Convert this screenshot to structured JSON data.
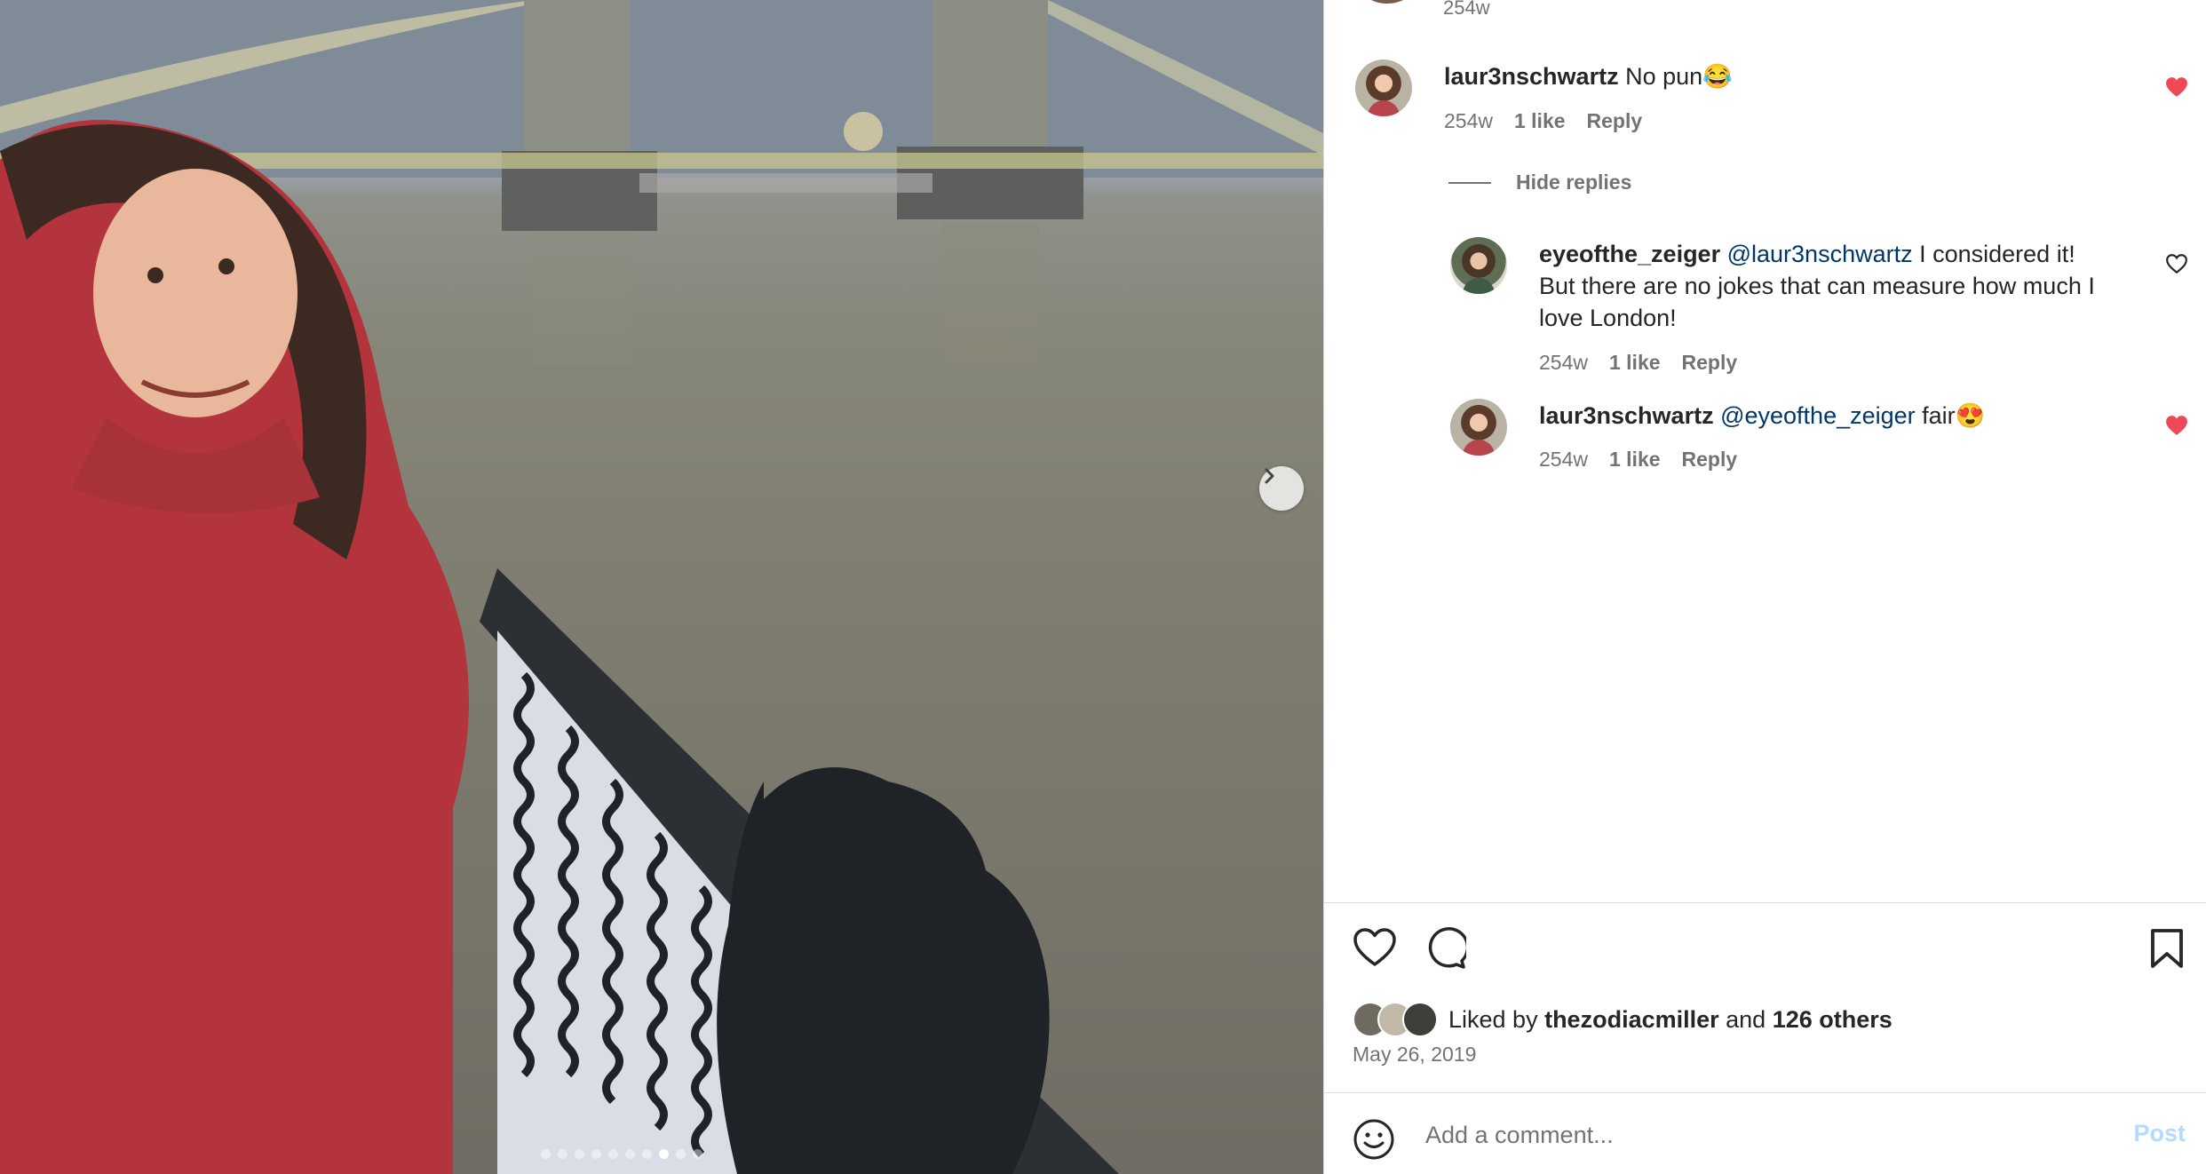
{
  "top_comment": {
    "time": "254w"
  },
  "comments": [
    {
      "username": "laur3nschwartz",
      "text": "No pun😂",
      "time": "254w",
      "likes": "1 like",
      "reply": "Reply",
      "liked": true
    }
  ],
  "hide_replies_label": "Hide replies",
  "replies": [
    {
      "username": "eyeofthe_zeiger",
      "mention": "@laur3nschwartz",
      "text_line1": " I considered it!",
      "text_line2": "But there are no jokes that can measure how much I",
      "text_line3": "love London!",
      "time": "254w",
      "likes": "1 like",
      "reply": "Reply",
      "liked": false
    },
    {
      "username": "laur3nschwartz",
      "mention": "@eyeofthe_zeiger",
      "text": " fair😍",
      "time": "254w",
      "likes": "1 like",
      "reply": "Reply",
      "liked": true
    }
  ],
  "likes_section": {
    "prefix": "Liked by ",
    "user": "thezodiacmiller",
    "middle": " and ",
    "others": "126 others",
    "date": "May 26, 2019"
  },
  "comment_box": {
    "placeholder": "Add a comment...",
    "post_label": "Post"
  },
  "carousel": {
    "total": 10,
    "active": 8
  },
  "colors": {
    "liked_heart": "#ed4956",
    "mention": "#00376b",
    "post_disabled": "#b3dbff",
    "secondary_text": "#737373"
  },
  "icons": [
    "chevron-right-icon",
    "heart-icon",
    "comment-icon",
    "bookmark-icon",
    "emoji-icon"
  ]
}
